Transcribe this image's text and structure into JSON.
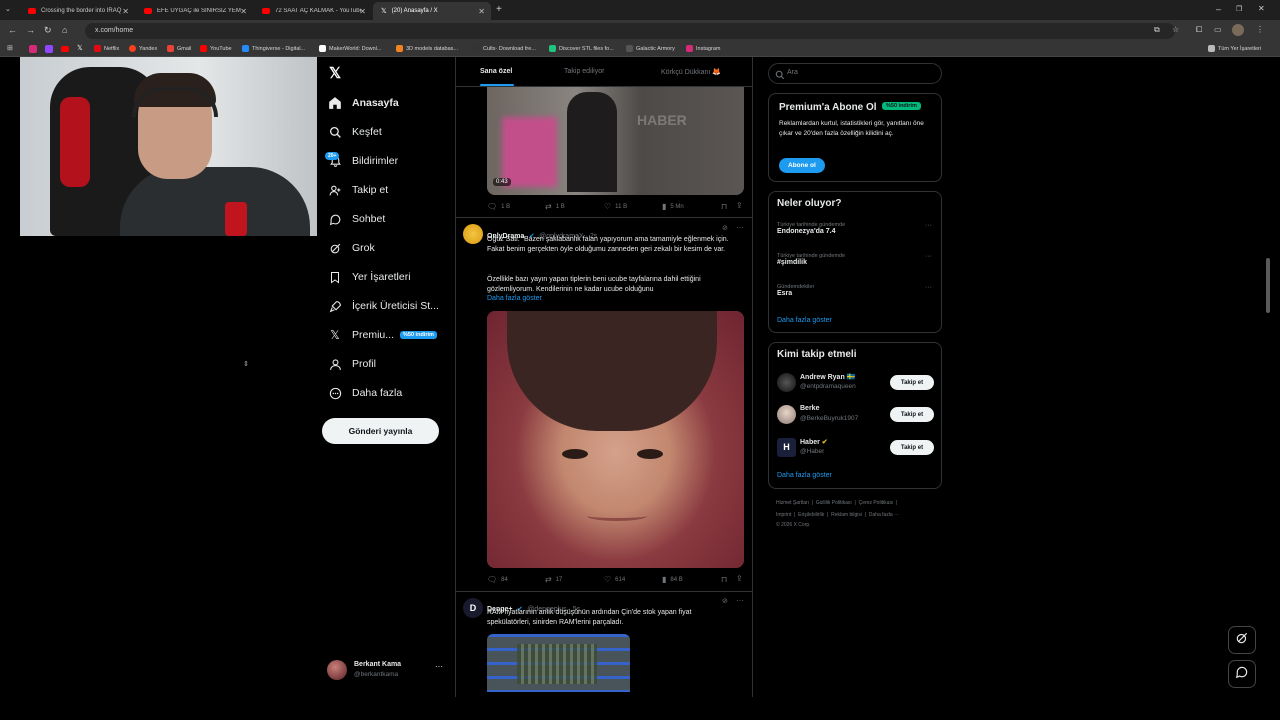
{
  "browser": {
    "tabs": [
      {
        "title": "Crossing the border into IRAQ",
        "kind": "youtube"
      },
      {
        "title": "EFE UYGAÇ ile SINIRSIZ YEMEK",
        "kind": "youtube"
      },
      {
        "title": "72 SAAT AÇ KALMAK - YouTube",
        "kind": "youtube"
      },
      {
        "title": "(20) Anasayfa / X",
        "kind": "x"
      }
    ],
    "url": "x.com/home",
    "bookmarks": [
      {
        "label": "Netflix",
        "color": "#e50914"
      },
      {
        "label": "Yandex",
        "color": "#fc3f1d"
      },
      {
        "label": "Gmail",
        "color": "#ea4335"
      },
      {
        "label": "YouTube",
        "color": "#ff0000"
      },
      {
        "label": "Thingiverse - Digital...",
        "color": "#248bfb"
      },
      {
        "label": "MakerWorld: Downl...",
        "color": "#ffffff"
      },
      {
        "label": "3D models databas...",
        "color": "#f58220"
      },
      {
        "label": "Cults· Download fre...",
        "color": "#333333"
      },
      {
        "label": "Discover STL files fo...",
        "color": "#1ec57e"
      },
      {
        "label": "Galactic Armory",
        "color": "#555555"
      },
      {
        "label": "Instagram",
        "color": "#d62976"
      }
    ],
    "all_bookmarks": "Tüm Yer İşaretleri"
  },
  "sidebar": {
    "items": [
      {
        "label": "Anasayfa",
        "icon": "home-icon"
      },
      {
        "label": "Keşfet",
        "icon": "search-icon"
      },
      {
        "label": "Bildirimler",
        "icon": "bell-icon"
      },
      {
        "label": "Takip et",
        "icon": "add-person-icon"
      },
      {
        "label": "Sohbet",
        "icon": "chat-icon"
      },
      {
        "label": "Grok",
        "icon": "grok-icon"
      },
      {
        "label": "Yer İşaretleri",
        "icon": "bookmark-icon"
      },
      {
        "label": "İçerik Üreticisi St...",
        "icon": "rocket-icon"
      },
      {
        "label": "Premiu...",
        "icon": "x-logo-icon"
      },
      {
        "label": "Profil",
        "icon": "person-icon"
      },
      {
        "label": "Daha fazla",
        "icon": "more-circle-icon"
      }
    ],
    "notifications_badge": "20+",
    "premium_badge": "%50 indirim",
    "post_button": "Gönderi yayınla",
    "account": {
      "name": "Berkant Kama",
      "handle": "@berkantkama"
    }
  },
  "feed": {
    "tabs": [
      "Sana özel",
      "Takip ediliyor",
      "Körkçü Dükkanı 🦊"
    ],
    "tweet1": {
      "video_duration": "0:43",
      "watermark": "HABER",
      "actions": {
        "replies": "1 B",
        "reposts": "1 B",
        "likes": "11 B",
        "views": "5 Mn"
      }
    },
    "tweet2": {
      "name": "OnlyDrama",
      "handle": "@onlydramaX · 2s",
      "text1": "Oğuz Sati: “Bazen şaklabanlık falan yapıyorum ama tamamiyle eğlenmek için. Fakat benim gerçekten öyle olduğumu zanneden geri zekalı bir kesim de var.",
      "text2": "Özellikle bazı yayın yapan tiplerin beni ucube tayfalarına dahil ettiğini gözlemliyorum. Kendilerinin ne kadar ucube olduğunu",
      "show_more": "Daha fazla göster",
      "actions": {
        "replies": "84",
        "reposts": "17",
        "likes": "614",
        "views": "84 B"
      }
    },
    "tweet3": {
      "name": "Denge+",
      "handle": "@dengeplus · 5s",
      "text": "RAM fiyatlarının anlık düşüşünün ardından Çin'de stok yapan fiyat spekülatörleri, sinirden RAM'lerini parçaladı."
    }
  },
  "right": {
    "search_placeholder": "Ara",
    "premium": {
      "title": "Premium'a Abone Ol",
      "badge": "%50 indirim",
      "text": "Reklamlardan kurtul, istatistikleri gör, yanıtlanı öne çıkar ve 20'den fazla özelliğin kilidini aç.",
      "button": "Abone ol"
    },
    "trends": {
      "title": "Neler oluyor?",
      "items": [
        {
          "context": "Türkiye tarihinde gündemde",
          "name": "Endonezya'da 7.4"
        },
        {
          "context": "Türkiye tarihinde gündemde",
          "name": "#şimdilik"
        },
        {
          "context": "Gündemdekiler",
          "name": "Esra"
        }
      ],
      "show_more": "Daha fazla göster"
    },
    "who_to_follow": {
      "title": "Kimi takip etmeli",
      "items": [
        {
          "name": "Andrew Ryan 🇸🇪",
          "handle": "@entpdramaqueen",
          "button": "Takip et"
        },
        {
          "name": "Berke",
          "handle": "@BerkeBuyruk1907",
          "button": "Takip et"
        },
        {
          "name": "Haber",
          "handle": "@Haber",
          "button": "Takip et"
        }
      ],
      "show_more": "Daha fazla göster"
    },
    "footer": {
      "line1": "Hizmet Şartları  |  Gizlilik Politikası  |  Çerez Politikası  |",
      "line2": "Imprint  |  Erişilebilirlik  |  Reklam bilgisi  |  Daha fazla ···",
      "line3": "© 2026 X Corp."
    }
  },
  "colors": {
    "accent": "#1d9bf0",
    "background": "#000000",
    "border": "#2f3336",
    "muted": "#71767b"
  }
}
